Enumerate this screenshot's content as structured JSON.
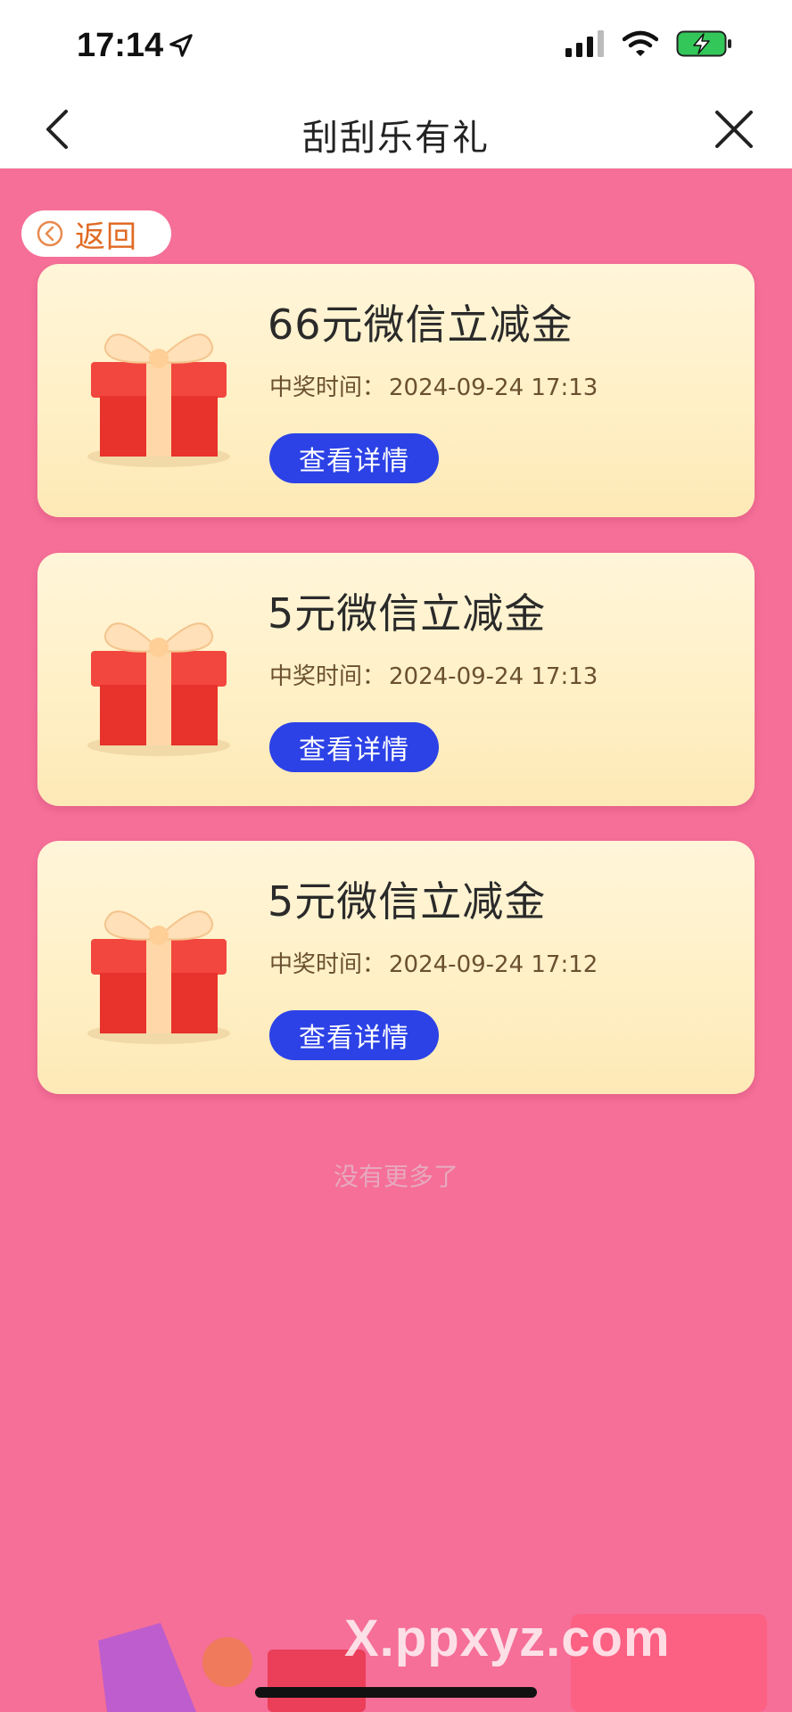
{
  "status_bar": {
    "time": "17:14"
  },
  "header": {
    "title": "刮刮乐有礼"
  },
  "return_button": {
    "label": "返回"
  },
  "prizes": [
    {
      "name": "66元微信立减金",
      "time_label": "中奖时间：",
      "time": "2024-09-24 17:13",
      "button": "查看详情"
    },
    {
      "name": "5元微信立减金",
      "time_label": "中奖时间：",
      "time": "2024-09-24 17:13",
      "button": "查看详情"
    },
    {
      "name": "5元微信立减金",
      "time_label": "中奖时间：",
      "time": "2024-09-24 17:12",
      "button": "查看详情"
    }
  ],
  "footer": {
    "no_more": "没有更多了"
  },
  "watermark": {
    "text": "X.ppxyz.com"
  },
  "colors": {
    "background": "#f56f98",
    "button": "#2c42e6",
    "card": "#fff3d2"
  }
}
